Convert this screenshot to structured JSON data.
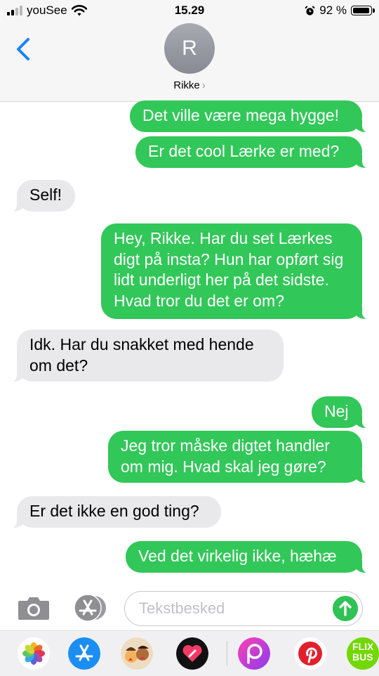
{
  "status_bar": {
    "carrier": "youSee",
    "time": "15.29",
    "battery": "92 %",
    "battery_level": 0.92,
    "signal_bars": 2
  },
  "header": {
    "avatar_initial": "R",
    "contact_name": "Rikke",
    "chevron": "›",
    "back_icon": "chevron-left-icon"
  },
  "messages": [
    {
      "direction": "sent",
      "text": "Det ville være mega hygge!"
    },
    {
      "direction": "sent",
      "text": "Er det cool Lærke er med?"
    },
    {
      "direction": "received",
      "text": "Self!"
    },
    {
      "direction": "sent",
      "text": "Hey, Rikke. Har du set Lærkes digt på insta? Hun har opført sig lidt underligt her på det sidste. Hvad tror du det er om?"
    },
    {
      "direction": "received",
      "text": "Idk. Har du snakket med hende om det?"
    },
    {
      "direction": "sent",
      "text": "Nej"
    },
    {
      "direction": "sent",
      "text": "Jeg tror måske digtet handler om mig. Hvad skal jeg gøre?"
    },
    {
      "direction": "received",
      "text": "Er det ikke en god ting?"
    },
    {
      "direction": "sent",
      "text": "Ved det virkelig ikke, hæhæ"
    }
  ],
  "composer": {
    "placeholder": "Tekstbesked",
    "camera_icon": "camera-icon",
    "apps_icon": "app-store-icon",
    "send_icon": "arrow-up-icon"
  },
  "app_drawer": {
    "apps": [
      "photos-icon",
      "app-store-icon",
      "memoji-icon",
      "digital-touch-icon",
      "picsart-icon",
      "pinterest-icon",
      "flixbus-icon"
    ],
    "flixbus_label_1": "FLIX",
    "flixbus_label_2": "BUS"
  },
  "colors": {
    "sent_bubble": "#32c759",
    "received_bubble": "#e9e9eb",
    "ios_blue": "#1a82fb",
    "header_bg": "#f6f6f6"
  }
}
